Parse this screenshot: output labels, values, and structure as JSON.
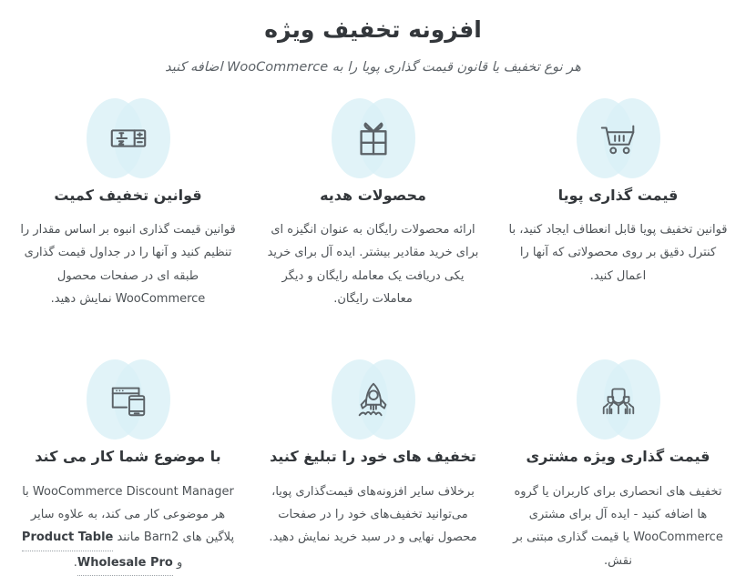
{
  "header": {
    "title": "افزونه تخفیف ویژه",
    "subtitle": "هر نوع تخفیف یا قانون قیمت گذاری پویا را به WooCommerce اضافه کنید"
  },
  "colors": {
    "badge_fill": "#d9eff6",
    "icon_stroke": "#5a6166",
    "title": "#33373b",
    "body_text": "#4d5256",
    "link": "#3b4045",
    "background": "#ffffff"
  },
  "features": [
    {
      "icon": "shopping-cart-icon",
      "title": "قیمت گذاری پویا",
      "desc": "قوانین تخفیف پویا قابل انعطاف ایجاد کنید، با کنترل دقیق بر روی محصولاتی که آنها را اعمال کنید."
    },
    {
      "icon": "gift-box-icon",
      "title": "محصولات هدیه",
      "desc": "ارائه محصولات رایگان به عنوان انگیزه ای برای خرید مقادیر بیشتر. ایده آل برای خرید یکی دریافت یک معامله رایگان و دیگر معاملات رایگان."
    },
    {
      "icon": "quantity-stepper-icon",
      "title": "قوانین تخفیف کمیت",
      "desc": "قوانین قیمت گذاری انبوه بر اساس مقدار را تنظیم کنید و آنها را در جداول قیمت گذاری طبقه ای در صفحات محصول WooCommerce نمایش دهید."
    },
    {
      "icon": "people-group-icon",
      "title": "قیمت گذاری ویژه مشتری",
      "desc": "تخفیف های انحصاری برای کاربران یا گروه ها اضافه کنید - ایده آل برای مشتری WooCommerce یا قیمت گذاری مبتنی بر نقش."
    },
    {
      "icon": "rocket-icon",
      "title": "تخفیف های خود را تبلیغ کنید",
      "desc": "برخلاف سایر افزونه‌های قیمت‌گذاری پویا، می‌توانید تخفیف‌های خود را در صفحات محصول نهایی و در سبد خرید نمایش دهید."
    },
    {
      "icon": "responsive-devices-icon",
      "title": "با موضوع شما کار می کند",
      "desc_part1": "WooCommerce Discount Manager",
      "desc_part2": " با هر موضوعی کار می کند، به علاوه سایر پلاگین های Barn2 مانند ",
      "link1": "Product Table",
      "conjunction": " و ",
      "link2": "Wholesale Pro",
      "desc_end": "."
    }
  ]
}
